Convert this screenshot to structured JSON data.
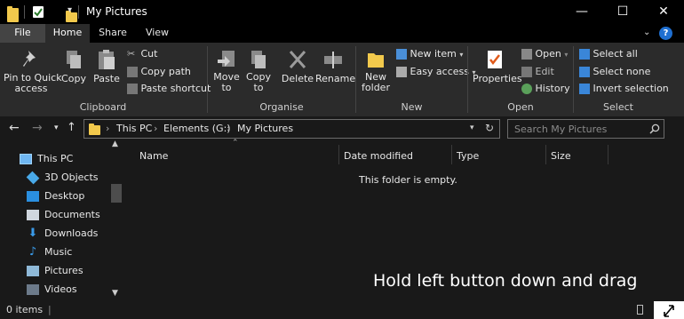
{
  "titlebar": {
    "title": "My Pictures",
    "minimize": "—",
    "maximize": "☐",
    "close": "✕",
    "qat_dropdown": "▾"
  },
  "tabs": {
    "file": "File",
    "home": "Home",
    "share": "Share",
    "view": "View",
    "help": "?",
    "collapse": "⌄"
  },
  "ribbon": {
    "clipboard": {
      "pin": "Pin to Quick\naccess",
      "copy": "Copy",
      "paste": "Paste",
      "cut": "Cut",
      "copy_path": "Copy path",
      "paste_shortcut": "Paste shortcut",
      "group": "Clipboard"
    },
    "organise": {
      "move_to": "Move\nto",
      "copy_to": "Copy\nto",
      "delete": "Delete",
      "rename": "Rename",
      "group": "Organise"
    },
    "new": {
      "new_folder": "New\nfolder",
      "new_item": "New item",
      "easy_access": "Easy access",
      "group": "New"
    },
    "open": {
      "properties": "Properties",
      "open": "Open",
      "edit": "Edit",
      "history": "History",
      "group": "Open"
    },
    "select": {
      "select_all": "Select all",
      "select_none": "Select none",
      "invert": "Invert selection",
      "group": "Select"
    }
  },
  "address": {
    "crumbs": [
      "This PC",
      "Elements (G:)",
      "My Pictures"
    ],
    "search_placeholder": "Search My Pictures"
  },
  "sidebar": {
    "items": [
      {
        "label": "This PC",
        "icon": "pc-icon"
      },
      {
        "label": "3D Objects",
        "icon": "cube-icon"
      },
      {
        "label": "Desktop",
        "icon": "desktop-icon"
      },
      {
        "label": "Documents",
        "icon": "documents-icon"
      },
      {
        "label": "Downloads",
        "icon": "download-icon"
      },
      {
        "label": "Music",
        "icon": "music-icon"
      },
      {
        "label": "Pictures",
        "icon": "pictures-icon"
      },
      {
        "label": "Videos",
        "icon": "videos-icon"
      }
    ]
  },
  "content": {
    "columns": [
      "Name",
      "Date modified",
      "Type",
      "Size"
    ],
    "empty_message": "This folder is empty."
  },
  "status": {
    "items": "0 items",
    "separator": "|"
  },
  "overlay": {
    "hint": "Hold left button down and drag"
  },
  "colors": {
    "accent": "#1f6fd1",
    "folder": "#f2c94c",
    "background": "#191919",
    "ribbon": "#2b2b2b"
  }
}
